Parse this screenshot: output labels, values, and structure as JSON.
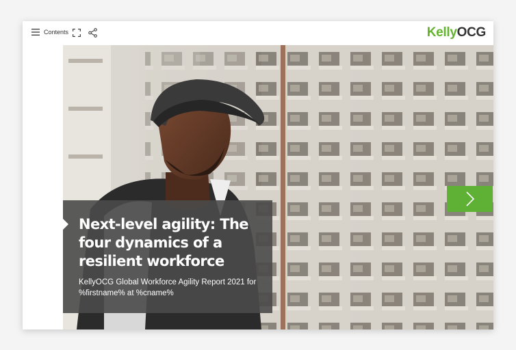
{
  "toolbar": {
    "contents_label": "Contents",
    "menu_icon": "hamburger-menu-icon",
    "expand_icon": "fullscreen-expand-icon",
    "share_icon": "share-icon"
  },
  "brand": {
    "logo_part1": "Kelly",
    "logo_part2": "OCG",
    "accent_color": "#63b32e"
  },
  "hero": {
    "title": "Next-level agility: The four dynamics of a resilient workforce",
    "subtitle": "KellyOCG Global Workforce Agility Report 2021 for %firstname% at %cname%",
    "next_icon": "chevron-right-icon",
    "next_button_color": "#5fb135"
  }
}
